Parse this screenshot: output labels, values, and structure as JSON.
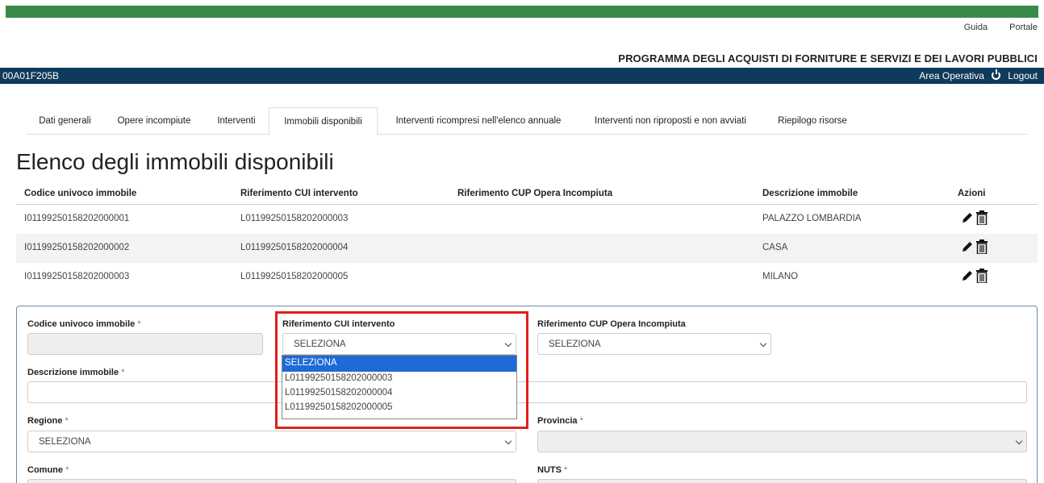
{
  "header": {
    "links": [
      "Guida",
      "Portale"
    ],
    "app_title": "PROGRAMMA DEGLI ACQUISTI DI FORNITURE E SERVIZI E DEI LAVORI PUBBLICI",
    "code": "00A01F205B",
    "area_operativa": "Area Operativa",
    "logout": "Logout"
  },
  "tabs": [
    {
      "label": "Dati generali"
    },
    {
      "label": "Opere incompiute"
    },
    {
      "label": "Interventi"
    },
    {
      "label": "Immobili disponibili",
      "active": true
    },
    {
      "label": "Interventi ricompresi nell'elenco annuale"
    },
    {
      "label": "Interventi non riproposti e non avviati"
    },
    {
      "label": "Riepilogo risorse"
    }
  ],
  "page_title": "Elenco degli immobili disponibili",
  "table": {
    "columns": [
      "Codice univoco immobile",
      "Riferimento CUI intervento",
      "Riferimento CUP Opera Incompiuta",
      "Descrizione immobile",
      "Azioni"
    ],
    "rows": [
      {
        "codice": "I01199250158202000001",
        "cui": "L01199250158202000003",
        "cup": "",
        "descrizione": "PALAZZO LOMBARDIA"
      },
      {
        "codice": "I01199250158202000002",
        "cui": "L01199250158202000004",
        "cup": "",
        "descrizione": "CASA"
      },
      {
        "codice": "I01199250158202000003",
        "cui": "L01199250158202000005",
        "cup": "",
        "descrizione": "MILANO"
      }
    ]
  },
  "form": {
    "codice_label": "Codice univoco immobile",
    "cui_label": "Riferimento CUI intervento",
    "cup_label": "Riferimento CUP Opera Incompiuta",
    "descrizione_label": "Descrizione immobile",
    "regione_label": "Regione",
    "provincia_label": "Provincia",
    "comune_label": "Comune",
    "nuts_label": "NUTS",
    "required_mark": "*",
    "cui_value": "SELEZIONA",
    "cup_value": "SELEZIONA",
    "regione_value": "SELEZIONA",
    "cui_options": [
      "SELEZIONA",
      "L01199250158202000003",
      "L01199250158202000004",
      "L01199250158202000005"
    ]
  },
  "colors": {
    "top_bar": "#3a8a4b",
    "navbar": "#0e3a5c",
    "dropdown_selected": "#1e6ad6",
    "highlight": "#e0201c"
  },
  "icons": {
    "edit": "pencil-icon",
    "delete": "trash-icon",
    "logout": "power-icon",
    "select": "chevron-down-icon"
  }
}
